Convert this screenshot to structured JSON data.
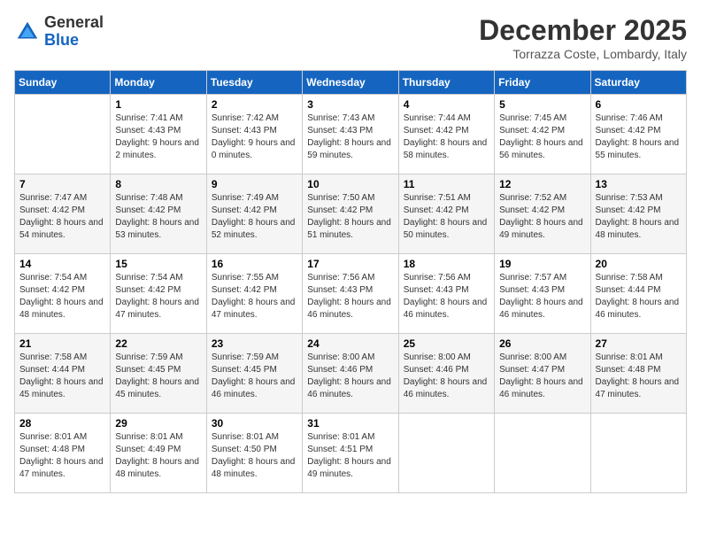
{
  "logo": {
    "general": "General",
    "blue": "Blue"
  },
  "title": "December 2025",
  "subtitle": "Torrazza Coste, Lombardy, Italy",
  "days_of_week": [
    "Sunday",
    "Monday",
    "Tuesday",
    "Wednesday",
    "Thursday",
    "Friday",
    "Saturday"
  ],
  "weeks": [
    [
      {
        "day": "",
        "sunrise": "",
        "sunset": "",
        "daylight": ""
      },
      {
        "day": "1",
        "sunrise": "Sunrise: 7:41 AM",
        "sunset": "Sunset: 4:43 PM",
        "daylight": "Daylight: 9 hours and 2 minutes."
      },
      {
        "day": "2",
        "sunrise": "Sunrise: 7:42 AM",
        "sunset": "Sunset: 4:43 PM",
        "daylight": "Daylight: 9 hours and 0 minutes."
      },
      {
        "day": "3",
        "sunrise": "Sunrise: 7:43 AM",
        "sunset": "Sunset: 4:43 PM",
        "daylight": "Daylight: 8 hours and 59 minutes."
      },
      {
        "day": "4",
        "sunrise": "Sunrise: 7:44 AM",
        "sunset": "Sunset: 4:42 PM",
        "daylight": "Daylight: 8 hours and 58 minutes."
      },
      {
        "day": "5",
        "sunrise": "Sunrise: 7:45 AM",
        "sunset": "Sunset: 4:42 PM",
        "daylight": "Daylight: 8 hours and 56 minutes."
      },
      {
        "day": "6",
        "sunrise": "Sunrise: 7:46 AM",
        "sunset": "Sunset: 4:42 PM",
        "daylight": "Daylight: 8 hours and 55 minutes."
      }
    ],
    [
      {
        "day": "7",
        "sunrise": "Sunrise: 7:47 AM",
        "sunset": "Sunset: 4:42 PM",
        "daylight": "Daylight: 8 hours and 54 minutes."
      },
      {
        "day": "8",
        "sunrise": "Sunrise: 7:48 AM",
        "sunset": "Sunset: 4:42 PM",
        "daylight": "Daylight: 8 hours and 53 minutes."
      },
      {
        "day": "9",
        "sunrise": "Sunrise: 7:49 AM",
        "sunset": "Sunset: 4:42 PM",
        "daylight": "Daylight: 8 hours and 52 minutes."
      },
      {
        "day": "10",
        "sunrise": "Sunrise: 7:50 AM",
        "sunset": "Sunset: 4:42 PM",
        "daylight": "Daylight: 8 hours and 51 minutes."
      },
      {
        "day": "11",
        "sunrise": "Sunrise: 7:51 AM",
        "sunset": "Sunset: 4:42 PM",
        "daylight": "Daylight: 8 hours and 50 minutes."
      },
      {
        "day": "12",
        "sunrise": "Sunrise: 7:52 AM",
        "sunset": "Sunset: 4:42 PM",
        "daylight": "Daylight: 8 hours and 49 minutes."
      },
      {
        "day": "13",
        "sunrise": "Sunrise: 7:53 AM",
        "sunset": "Sunset: 4:42 PM",
        "daylight": "Daylight: 8 hours and 48 minutes."
      }
    ],
    [
      {
        "day": "14",
        "sunrise": "Sunrise: 7:54 AM",
        "sunset": "Sunset: 4:42 PM",
        "daylight": "Daylight: 8 hours and 48 minutes."
      },
      {
        "day": "15",
        "sunrise": "Sunrise: 7:54 AM",
        "sunset": "Sunset: 4:42 PM",
        "daylight": "Daylight: 8 hours and 47 minutes."
      },
      {
        "day": "16",
        "sunrise": "Sunrise: 7:55 AM",
        "sunset": "Sunset: 4:42 PM",
        "daylight": "Daylight: 8 hours and 47 minutes."
      },
      {
        "day": "17",
        "sunrise": "Sunrise: 7:56 AM",
        "sunset": "Sunset: 4:43 PM",
        "daylight": "Daylight: 8 hours and 46 minutes."
      },
      {
        "day": "18",
        "sunrise": "Sunrise: 7:56 AM",
        "sunset": "Sunset: 4:43 PM",
        "daylight": "Daylight: 8 hours and 46 minutes."
      },
      {
        "day": "19",
        "sunrise": "Sunrise: 7:57 AM",
        "sunset": "Sunset: 4:43 PM",
        "daylight": "Daylight: 8 hours and 46 minutes."
      },
      {
        "day": "20",
        "sunrise": "Sunrise: 7:58 AM",
        "sunset": "Sunset: 4:44 PM",
        "daylight": "Daylight: 8 hours and 46 minutes."
      }
    ],
    [
      {
        "day": "21",
        "sunrise": "Sunrise: 7:58 AM",
        "sunset": "Sunset: 4:44 PM",
        "daylight": "Daylight: 8 hours and 45 minutes."
      },
      {
        "day": "22",
        "sunrise": "Sunrise: 7:59 AM",
        "sunset": "Sunset: 4:45 PM",
        "daylight": "Daylight: 8 hours and 45 minutes."
      },
      {
        "day": "23",
        "sunrise": "Sunrise: 7:59 AM",
        "sunset": "Sunset: 4:45 PM",
        "daylight": "Daylight: 8 hours and 46 minutes."
      },
      {
        "day": "24",
        "sunrise": "Sunrise: 8:00 AM",
        "sunset": "Sunset: 4:46 PM",
        "daylight": "Daylight: 8 hours and 46 minutes."
      },
      {
        "day": "25",
        "sunrise": "Sunrise: 8:00 AM",
        "sunset": "Sunset: 4:46 PM",
        "daylight": "Daylight: 8 hours and 46 minutes."
      },
      {
        "day": "26",
        "sunrise": "Sunrise: 8:00 AM",
        "sunset": "Sunset: 4:47 PM",
        "daylight": "Daylight: 8 hours and 46 minutes."
      },
      {
        "day": "27",
        "sunrise": "Sunrise: 8:01 AM",
        "sunset": "Sunset: 4:48 PM",
        "daylight": "Daylight: 8 hours and 47 minutes."
      }
    ],
    [
      {
        "day": "28",
        "sunrise": "Sunrise: 8:01 AM",
        "sunset": "Sunset: 4:48 PM",
        "daylight": "Daylight: 8 hours and 47 minutes."
      },
      {
        "day": "29",
        "sunrise": "Sunrise: 8:01 AM",
        "sunset": "Sunset: 4:49 PM",
        "daylight": "Daylight: 8 hours and 48 minutes."
      },
      {
        "day": "30",
        "sunrise": "Sunrise: 8:01 AM",
        "sunset": "Sunset: 4:50 PM",
        "daylight": "Daylight: 8 hours and 48 minutes."
      },
      {
        "day": "31",
        "sunrise": "Sunrise: 8:01 AM",
        "sunset": "Sunset: 4:51 PM",
        "daylight": "Daylight: 8 hours and 49 minutes."
      },
      {
        "day": "",
        "sunrise": "",
        "sunset": "",
        "daylight": ""
      },
      {
        "day": "",
        "sunrise": "",
        "sunset": "",
        "daylight": ""
      },
      {
        "day": "",
        "sunrise": "",
        "sunset": "",
        "daylight": ""
      }
    ]
  ]
}
